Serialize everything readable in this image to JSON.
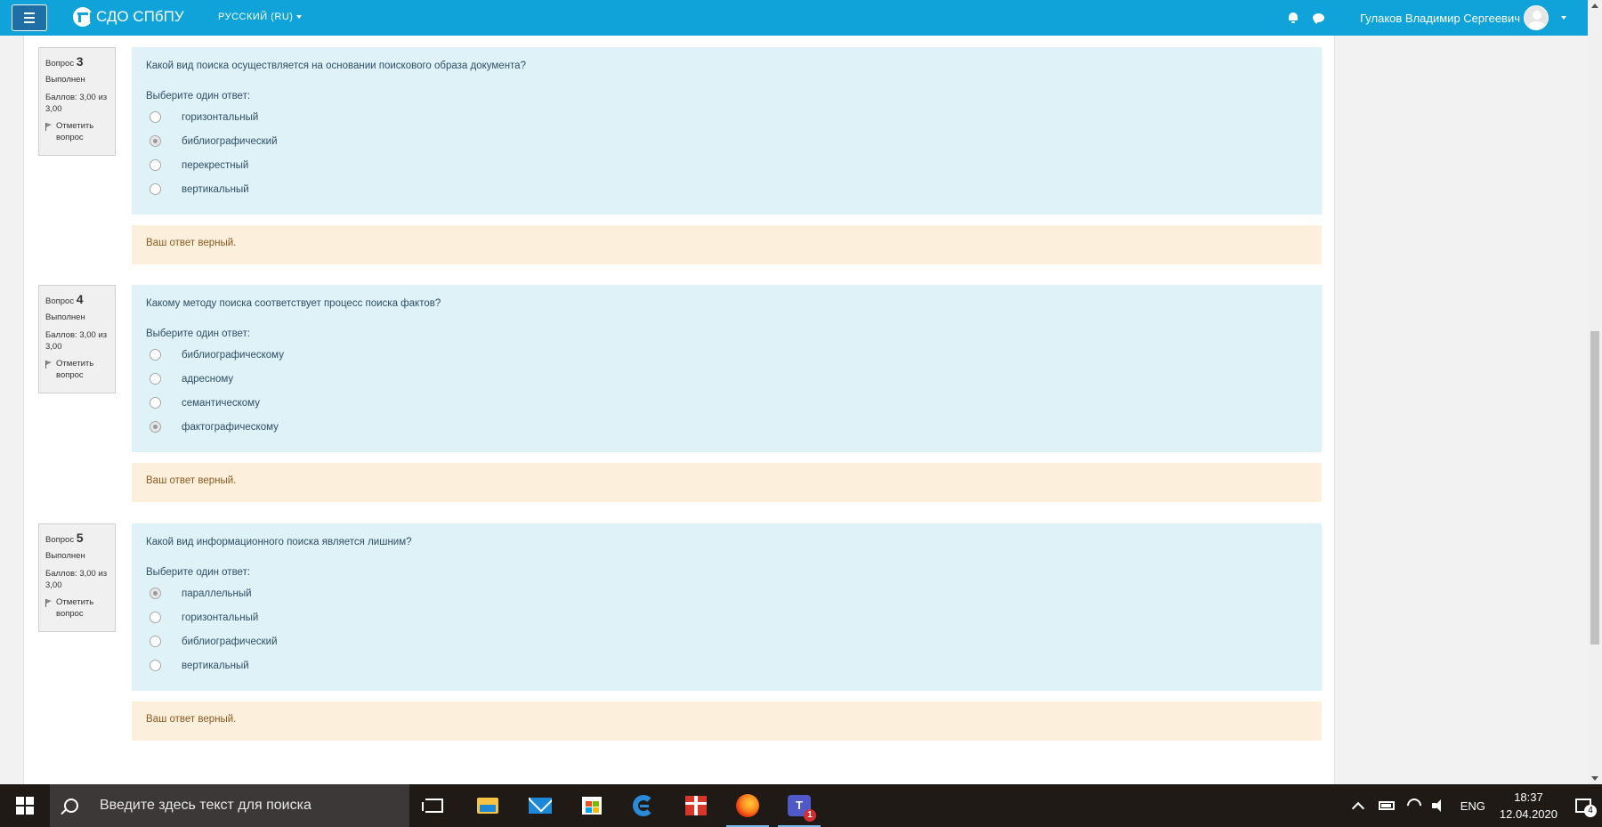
{
  "navbar": {
    "site_name": "СДО СПбПУ",
    "language": "Русский (ru)",
    "user_name": "Гулаков Владимир Сергеевич"
  },
  "questions": [
    {
      "label": "Вопрос",
      "number": "3",
      "state": "Выполнен",
      "grade": "Баллов: 3,00 из 3,00",
      "flag_label": "Отметить вопрос",
      "text": "Какой вид поиска осуществляется на основании поискового образа документа?",
      "prompt": "Выберите один ответ:",
      "answers": [
        {
          "label": "горизонтальный",
          "checked": false
        },
        {
          "label": "библиографический",
          "checked": true
        },
        {
          "label": "перекрестный",
          "checked": false
        },
        {
          "label": "вертикальный",
          "checked": false
        }
      ],
      "feedback": "Ваш ответ верный."
    },
    {
      "label": "Вопрос",
      "number": "4",
      "state": "Выполнен",
      "grade": "Баллов: 3,00 из 3,00",
      "flag_label": "Отметить вопрос",
      "text": "Какому методу поиска соответствует процесс поиска фактов?",
      "prompt": "Выберите один ответ:",
      "answers": [
        {
          "label": "библиографическому",
          "checked": false
        },
        {
          "label": "адресному",
          "checked": false
        },
        {
          "label": "семантическому",
          "checked": false
        },
        {
          "label": "фактографическому",
          "checked": true
        }
      ],
      "feedback": "Ваш ответ верный."
    },
    {
      "label": "Вопрос",
      "number": "5",
      "state": "Выполнен",
      "grade": "Баллов: 3,00 из 3,00",
      "flag_label": "Отметить вопрос",
      "text": "Какой вид информационного поиска является лишним?",
      "prompt": "Выберите один ответ:",
      "answers": [
        {
          "label": "параллельный",
          "checked": true
        },
        {
          "label": "горизонтальный",
          "checked": false
        },
        {
          "label": "библиографический",
          "checked": false
        },
        {
          "label": "вертикальный",
          "checked": false
        }
      ],
      "feedback": "Ваш ответ верный."
    }
  ],
  "taskbar": {
    "search_placeholder": "Введите здесь текст для поиска",
    "teams_badge": "1",
    "language": "ENG",
    "time": "18:37",
    "date": "12.04.2020",
    "notifications": "4"
  }
}
